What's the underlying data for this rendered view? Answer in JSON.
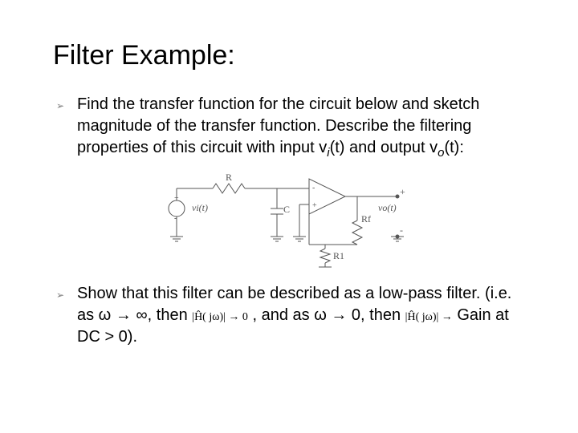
{
  "title": "Filter Example:",
  "bullets": [
    {
      "pre": "Find the transfer function for the circuit below and sketch magnitude of the transfer function.  Describe the filtering properties of this circuit with input ",
      "vi": "v",
      "vi_sub": "i",
      "mid1": "(t) and output ",
      "vo": "v",
      "vo_sub": "o",
      "post": "(t):"
    },
    {
      "pre": "Show that this filter can be described as a low-pass filter. (i.e.  as ω → ∞, then ",
      "math1": "|Ĥ( jω)| → 0",
      "mid": " , and as ω → 0, then ",
      "math2": "|Ĥ( jω)| →",
      "post": " Gain at DC > 0)."
    }
  ],
  "circuit": {
    "R": "R",
    "C": "C",
    "Rf": "Rf",
    "R1": "R1",
    "vi": "vi(t)",
    "vo": "vo(t)",
    "plus": "+",
    "minus": "-"
  }
}
